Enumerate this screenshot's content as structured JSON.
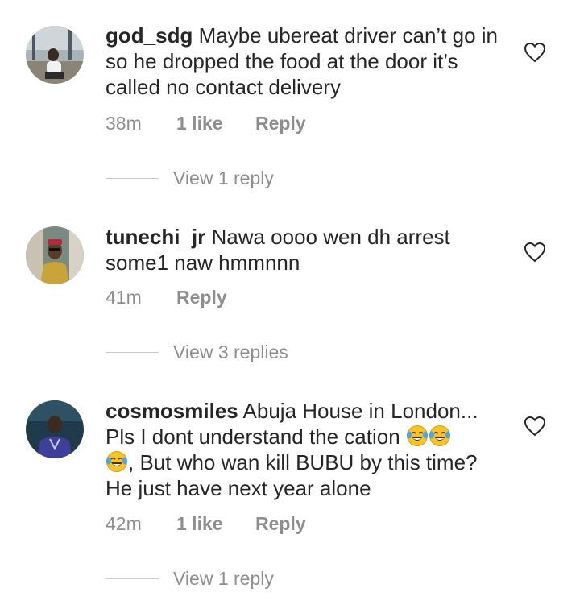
{
  "comments": [
    {
      "username": "god_sdg",
      "text": "Maybe ubereat driver can’t go in so he dropped the food at the door it’s called no contact delivery",
      "time": "38m",
      "likes": "1 like",
      "reply": "Reply",
      "view_replies": "View 1 reply"
    },
    {
      "username": "tunechi_jr",
      "text": "Nawa oooo wen dh arrest some1 naw hmmnnn",
      "time": "41m",
      "reply": "Reply",
      "view_replies": "View 3 replies"
    },
    {
      "username": "cosmosmiles",
      "text_before": "Abuja House in London... Pls I dont understand the cation",
      "text_after": ", But who wan kill BUBU by this time? He just have next year alone",
      "emoji_name": "face-with-tears-of-joy",
      "emoji_count": 3,
      "time": "42m",
      "likes": "1 like",
      "reply": "Reply",
      "view_replies": "View 1 reply"
    }
  ],
  "icons": {
    "like": "heart-outline-icon"
  },
  "colors": {
    "text": "#262626",
    "secondary": "#8e8e8e",
    "divider": "#c7c7c7"
  }
}
